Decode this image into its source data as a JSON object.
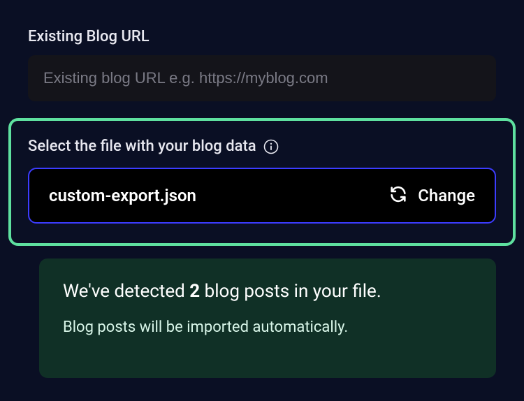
{
  "url_section": {
    "label": "Existing Blog URL",
    "placeholder": "Existing blog URL e.g. https://myblog.com",
    "value": ""
  },
  "file_section": {
    "label": "Select the file with your blog data",
    "filename": "custom-export.json",
    "change_label": "Change"
  },
  "status": {
    "prefix": "We've detected ",
    "count": "2",
    "suffix": " blog posts in your file.",
    "sub": "Blog posts will be imported automatically."
  },
  "colors": {
    "highlight_border": "#5ee09f",
    "file_box_border": "#3c3cff",
    "status_bg": "#103026"
  }
}
